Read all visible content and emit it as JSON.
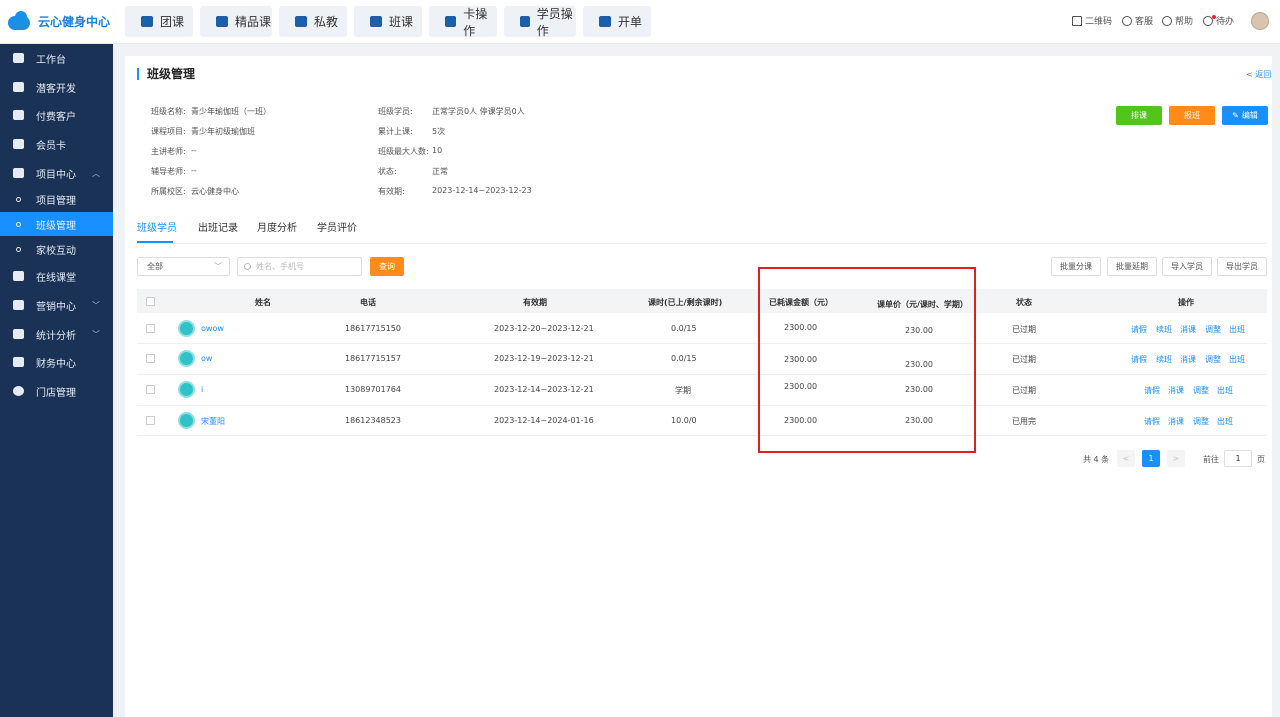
{
  "app": {
    "title": "云心健身中心"
  },
  "topnav": [
    {
      "label": "团课"
    },
    {
      "label": "精品课"
    },
    {
      "label": "私教"
    },
    {
      "label": "班课"
    },
    {
      "label": "卡操作"
    },
    {
      "label": "学员操作"
    },
    {
      "label": "开单"
    }
  ],
  "top_right": {
    "qrcode": "二维码",
    "service": "客服",
    "help": "帮助",
    "todo": "待办"
  },
  "sidebar": {
    "items": [
      {
        "label": "工作台",
        "icon": "monitor-icon"
      },
      {
        "label": "潜客开发",
        "icon": "id-card-icon"
      },
      {
        "label": "付费客户",
        "icon": "users-icon"
      },
      {
        "label": "会员卡",
        "icon": "card-icon"
      },
      {
        "label": "项目中心",
        "icon": "project-icon"
      },
      {
        "label": "项目管理"
      },
      {
        "label": "班级管理"
      },
      {
        "label": "家校互动"
      },
      {
        "label": "在线课堂",
        "icon": "video-icon"
      },
      {
        "label": "营销中心",
        "icon": "tag-icon"
      },
      {
        "label": "统计分析",
        "icon": "chart-icon"
      },
      {
        "label": "财务中心",
        "icon": "wallet-icon"
      },
      {
        "label": "门店管理",
        "icon": "store-icon"
      }
    ]
  },
  "page": {
    "title": "班级管理",
    "back": "< 返回"
  },
  "class_info": {
    "name_label": "班级名称:",
    "name_value": "青少年瑜伽班（一班）",
    "course_label": "课程项目:",
    "course_value": "青少年初级瑜伽班",
    "teacher_label": "主讲老师:",
    "teacher_value": "--",
    "assistant_label": "辅导老师:",
    "assistant_value": "--",
    "campus_label": "所属校区:",
    "campus_value": "云心健身中心",
    "students_label": "班级学员:",
    "students_value": "正常学员0人 停课学员0人",
    "lessons_label": "累计上课:",
    "lessons_value": "5次",
    "max_label": "班级最大人数:",
    "max_value": "10",
    "status_label": "状态:",
    "status_value": "正常",
    "validity_label": "有效期:",
    "validity_value": "2023-12-14~2023-12-23"
  },
  "actions": {
    "schedule": "排课",
    "enroll": "报班",
    "edit": "编辑"
  },
  "tabs": [
    {
      "label": "班级学员"
    },
    {
      "label": "出班记录"
    },
    {
      "label": "月度分析"
    },
    {
      "label": "学员评价"
    }
  ],
  "filter": {
    "select_value": "全部",
    "search_placeholder": "姓名、手机号",
    "query": "查询"
  },
  "tools": {
    "batch_class": "批量分课",
    "batch_extend": "批量延期",
    "import": "导入学员",
    "export": "导出学员"
  },
  "table": {
    "headers": {
      "name": "姓名",
      "phone": "电话",
      "validity": "有效期",
      "lessons": "课时(已上/剩余课时)",
      "consumed": "已耗课金额（元）",
      "unit_price": "课单价（元/课时、学期）",
      "status": "状态",
      "ops": "操作"
    },
    "rows": [
      {
        "name": "owow",
        "phone": "18617715150",
        "validity": "2023-12-20~2023-12-21",
        "lessons": "0.0/15",
        "consumed": "2300.00",
        "unit_price": "230.00",
        "status": "已过期",
        "ops": [
          "请假",
          "续班",
          "消课",
          "调整",
          "出班"
        ]
      },
      {
        "name": "ow",
        "phone": "18617715157",
        "validity": "2023-12-19~2023-12-21",
        "lessons": "0.0/15",
        "consumed": "2300.00",
        "unit_price": "230.00",
        "status": "已过期",
        "ops": [
          "请假",
          "续班",
          "消课",
          "调整",
          "出班"
        ]
      },
      {
        "name": "i",
        "phone": "13089701764",
        "validity": "2023-12-14~2023-12-21",
        "lessons": "学期",
        "consumed": "2300.00",
        "unit_price": "230.00",
        "status": "已过期",
        "ops": [
          "请假",
          "消课",
          "调整",
          "出班"
        ]
      },
      {
        "name": "宋董阳",
        "phone": "18612348523",
        "validity": "2023-12-14~2024-01-16",
        "lessons": "10.0/0",
        "consumed": "2300.00",
        "unit_price": "230.00",
        "status": "已用完",
        "ops": [
          "请假",
          "消课",
          "调整",
          "出班"
        ]
      }
    ]
  },
  "pagination": {
    "total": "共 4 条",
    "prev": "<",
    "current": "1",
    "next": ">",
    "goto": "前往",
    "page_input": "1",
    "unit": "页"
  },
  "colors": {
    "primary": "#1890ff",
    "sidebar": "#1b3257",
    "orange": "#ff8c1a",
    "green": "#52c41a",
    "highlight": "#e02020"
  }
}
